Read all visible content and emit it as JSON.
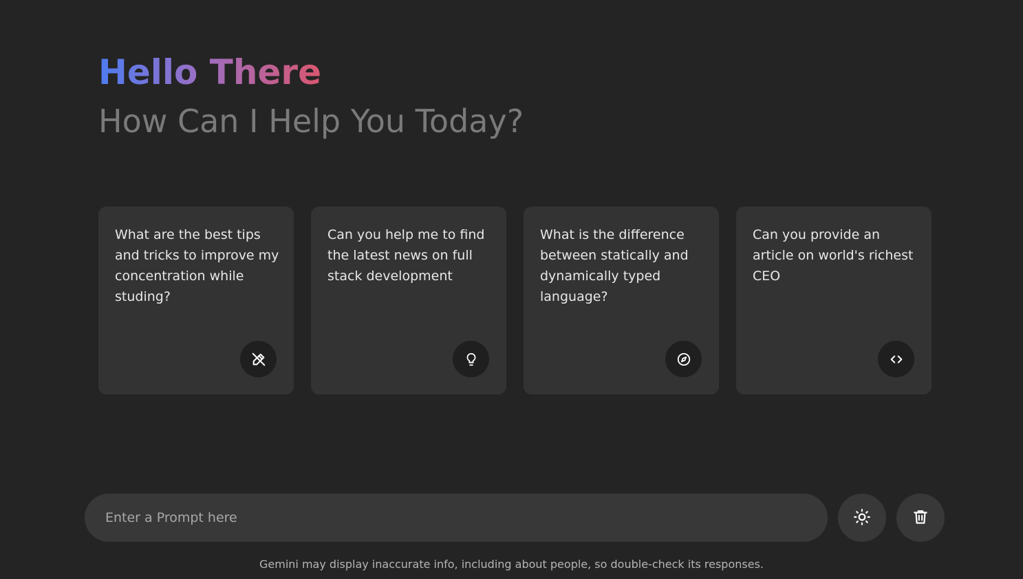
{
  "header": {
    "title": "Hello There",
    "subtitle": "How Can I Help You Today?"
  },
  "cards": [
    {
      "text": "What are the best tips and tricks to improve my concentration while studing?",
      "icon": "draw-icon"
    },
    {
      "text": "Can you help me to find the latest news on full stack development",
      "icon": "lightbulb-icon"
    },
    {
      "text": "What is the difference between statically and dynamically typed language?",
      "icon": "explore-icon"
    },
    {
      "text": "Can you provide an article on world's richest CEO",
      "icon": "code-icon"
    }
  ],
  "input": {
    "placeholder": "Enter a Prompt here"
  },
  "buttons": {
    "theme_icon": "sun-icon",
    "delete_icon": "trash-icon"
  },
  "footer": {
    "disclaimer": "Gemini may display inaccurate info, including about people, so double-check its responses."
  },
  "colors": {
    "background": "#242424",
    "card": "#333333",
    "gradient_start": "#4d7cf0",
    "gradient_end": "#d95770"
  }
}
